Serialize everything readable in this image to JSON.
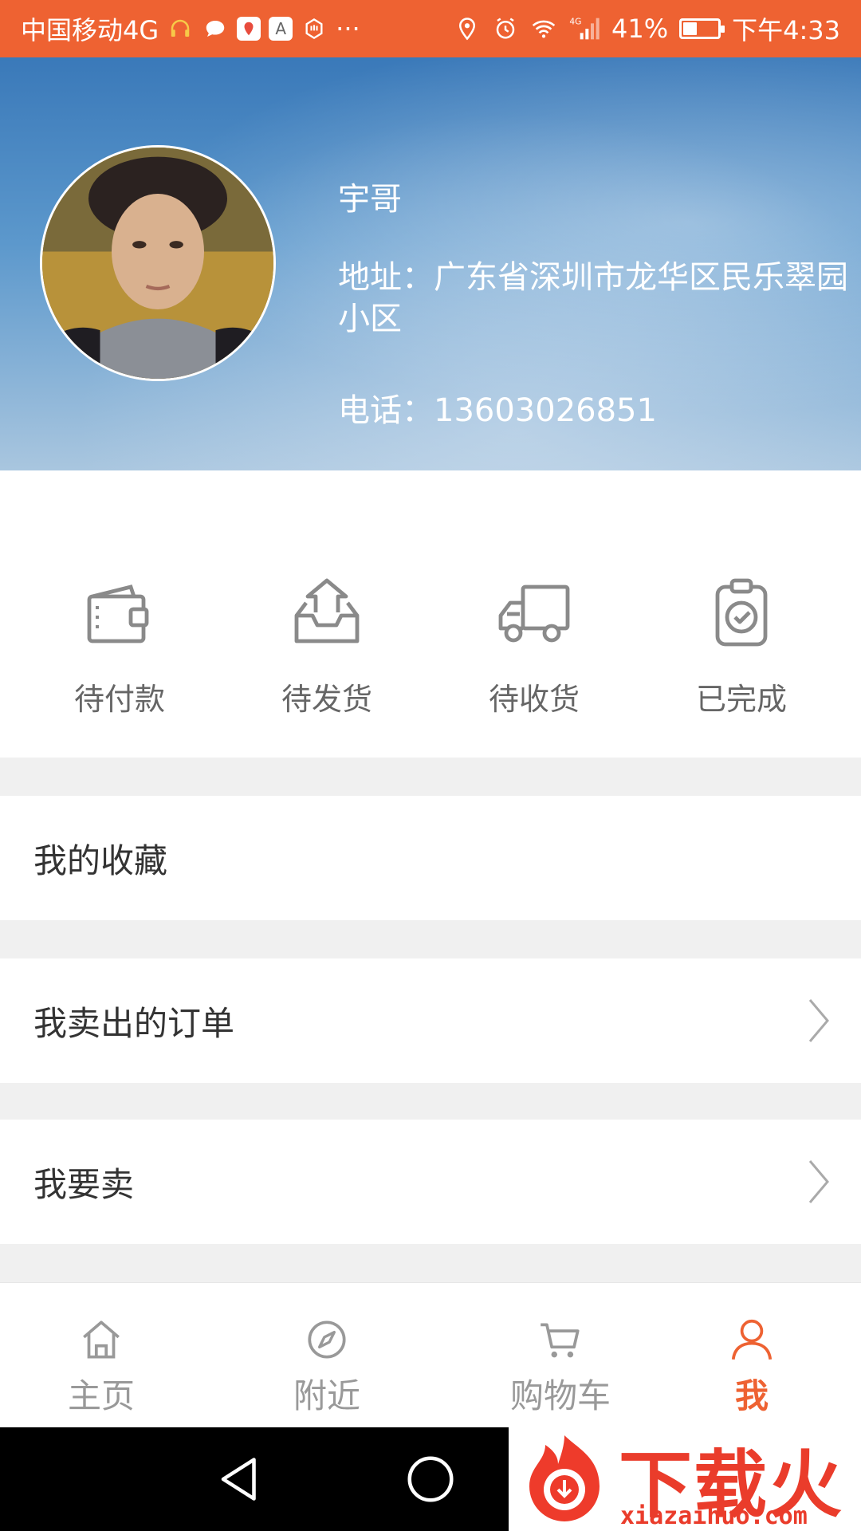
{
  "status_bar": {
    "carrier": "中国移动4G",
    "more": "···",
    "network": "4G",
    "battery": "41%",
    "battery_level": 0.41,
    "time": "下午4:33",
    "accent": "#ee6232"
  },
  "profile": {
    "name": "宇哥",
    "address": "地址：广东省深圳市龙华区民乐翠园小区",
    "phone": "电话：13603026851"
  },
  "orders": [
    {
      "label": "待付款",
      "icon": "wallet-icon"
    },
    {
      "label": "待发货",
      "icon": "outbox-icon"
    },
    {
      "label": "待收货",
      "icon": "truck-icon"
    },
    {
      "label": "已完成",
      "icon": "clipboard-check-icon"
    }
  ],
  "menu": [
    {
      "label": "我的收藏",
      "chevron": false
    },
    {
      "label": "我卖出的订单",
      "chevron": true
    },
    {
      "label": "我要卖",
      "chevron": true
    }
  ],
  "bottom_nav": [
    {
      "label": "主页",
      "icon": "home-icon",
      "active": false
    },
    {
      "label": "附近",
      "icon": "compass-icon",
      "active": false
    },
    {
      "label": "购物车",
      "icon": "cart-icon",
      "active": false
    },
    {
      "label": "我",
      "icon": "person-icon",
      "active": true
    }
  ],
  "watermark": {
    "text": "下载火",
    "url": "xiazaihuo.com"
  }
}
